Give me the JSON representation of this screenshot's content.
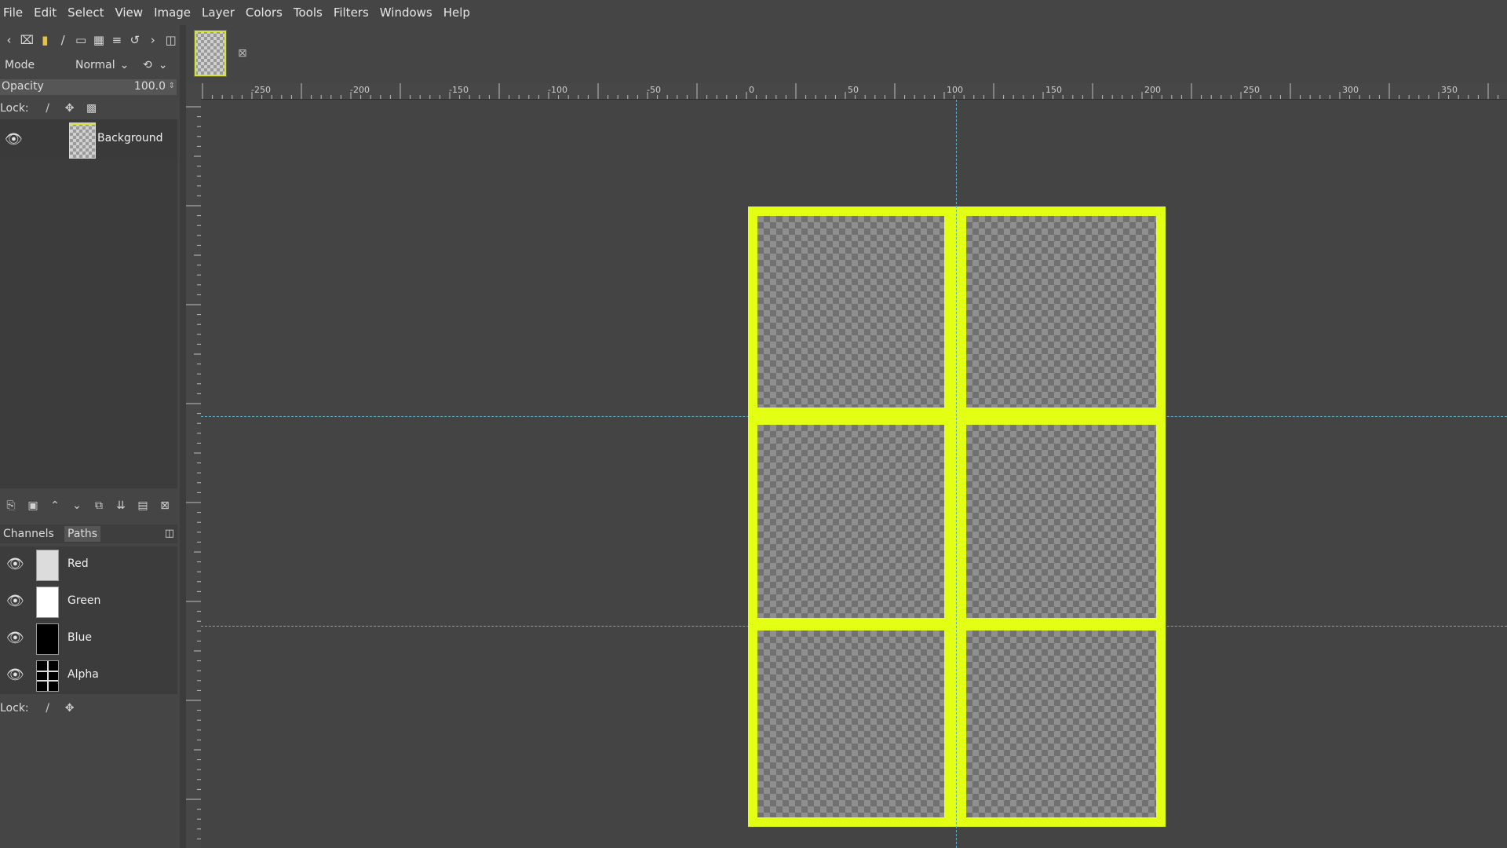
{
  "menubar": {
    "items": [
      "File",
      "Edit",
      "Select",
      "View",
      "Image",
      "Layer",
      "Colors",
      "Tools",
      "Filters",
      "Windows",
      "Help"
    ]
  },
  "layers_panel": {
    "mode_label": "Mode",
    "mode_value": "Normal",
    "opacity_label": "Opacity",
    "opacity_value": "100.0",
    "lock_label": "Lock:",
    "layers": [
      {
        "name": "Background",
        "visible": true
      }
    ]
  },
  "channels_panel": {
    "tabs": [
      "Channels",
      "Paths"
    ],
    "channels": [
      {
        "name": "Red",
        "thumb_color": "#dcdcdc"
      },
      {
        "name": "Green",
        "thumb_color": "#ffffff"
      },
      {
        "name": "Blue",
        "thumb_color": "#000000"
      },
      {
        "name": "Alpha",
        "thumb_color": "#000000"
      }
    ],
    "lock_label": "Lock:"
  },
  "ruler": {
    "top_labels": [
      "-250",
      "-200",
      "-150",
      "-100",
      "-50",
      "0",
      "50",
      "100",
      "150",
      "200",
      "250",
      "300",
      "350"
    ]
  },
  "colors": {
    "accent_yellow": "#e3ff13",
    "guide_cyan": "#5fb0c4",
    "background": "#454545"
  }
}
